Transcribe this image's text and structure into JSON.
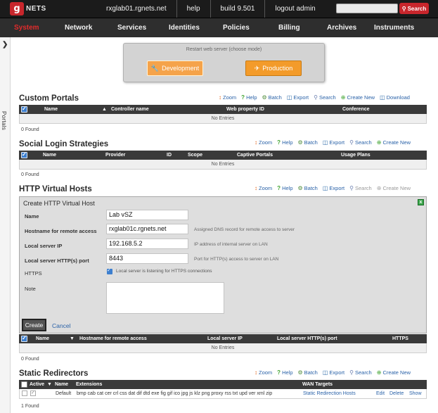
{
  "header": {
    "logo_mark": "g",
    "logo_text": "NETS",
    "links": [
      "rxglab01.rgnets.net",
      "help",
      "build 9.501",
      "logout admin"
    ],
    "search_placeholder": "",
    "search_button": "Search"
  },
  "nav": {
    "items": [
      "System",
      "Network",
      "Services",
      "Identities",
      "Policies",
      "Billing",
      "Archives",
      "Instruments"
    ],
    "active": "System"
  },
  "sidebar": {
    "toggle_icon": "chevron-right-icon",
    "label": "Portals"
  },
  "restart": {
    "title": "Restart web server (choose mode)",
    "development": "Development",
    "production": "Production"
  },
  "custom_portals": {
    "title": "Custom Portals",
    "actions": [
      "Zoom",
      "Help",
      "Batch",
      "Export",
      "Search",
      "Create New",
      "Download"
    ],
    "columns": [
      "Name",
      "Controller name",
      "Web property ID",
      "Conference"
    ],
    "empty": "No Entries",
    "found": "0 Found"
  },
  "social_login": {
    "title": "Social Login Strategies",
    "actions": [
      "Zoom",
      "Help",
      "Batch",
      "Export",
      "Search",
      "Create New"
    ],
    "columns": [
      "Name",
      "Provider",
      "ID",
      "Scope",
      "Captive Portals",
      "Usage Plans"
    ],
    "empty": "No Entries",
    "found": "0 Found"
  },
  "http_virtual_hosts": {
    "title": "HTTP Virtual Hosts",
    "actions": [
      "Zoom",
      "Help",
      "Batch",
      "Export",
      "Search",
      "Create New"
    ],
    "form": {
      "title": "Create HTTP Virtual Host",
      "fields": [
        {
          "label": "Name",
          "value": "Lab vSZ",
          "hint": ""
        },
        {
          "label": "Hostname for remote access",
          "value": "rxglab01c.rgnets.net",
          "hint": "Assigned DNS record for remote access to server"
        },
        {
          "label": "Local server IP",
          "value": "192.168.5.2",
          "hint": "IP address of internal server on LAN"
        },
        {
          "label": "Local server HTTP(s) port",
          "value": "8443",
          "hint": "Port for HTTP(s) access to server on LAN"
        }
      ],
      "https_label": "HTTPS",
      "https_checkbox_text": "Local server is listening for HTTPS connections",
      "https_checked": true,
      "note_label": "Note",
      "note_value": "",
      "create": "Create",
      "cancel": "Cancel"
    },
    "columns": [
      "Name",
      "Hostname for remote access",
      "Local server IP",
      "Local server HTTP(s) port",
      "HTTPS"
    ],
    "empty": "No Entries",
    "found": "0 Found"
  },
  "static_redirectors": {
    "title": "Static Redirectors",
    "actions": [
      "Zoom",
      "Help",
      "Batch",
      "Export",
      "Search",
      "Create New"
    ],
    "columns": [
      "Active",
      "Name",
      "Extensions",
      "WAN Targets"
    ],
    "rows": [
      {
        "active": true,
        "name": "Default",
        "extensions": "bmp cab cat cer crl css dat dif dtd exe fig gif ico jpg js klz png proxy rss txt upd ver xml zip",
        "wan_targets": "Static Redirection Hosts",
        "row_actions": [
          "Edit",
          "Delete",
          "Show"
        ]
      }
    ],
    "found": "1 Found"
  },
  "colors": {
    "brand_red": "#c8262c",
    "nav_bg": "#2e2e2e",
    "link_blue": "#2a62a8",
    "orange_button": "#f39b2a"
  }
}
